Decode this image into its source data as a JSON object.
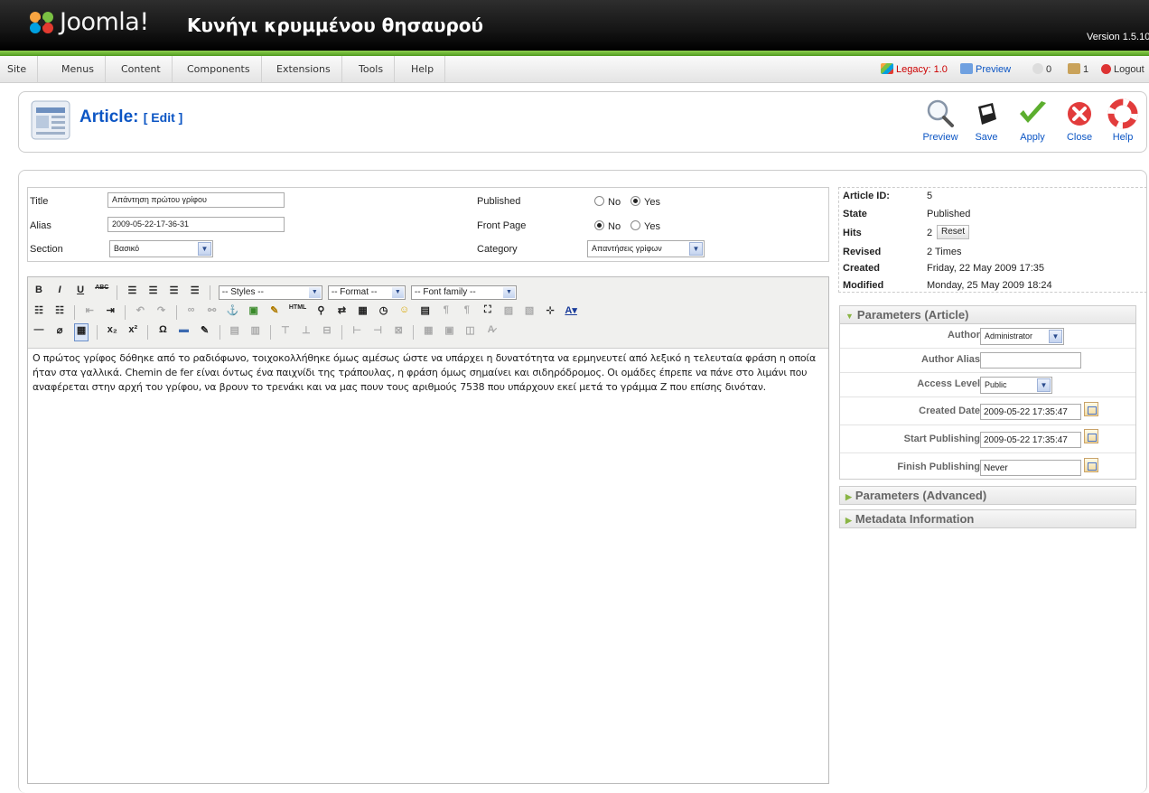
{
  "header": {
    "logo_text": "Joomla!",
    "site_title": "Κυνήγι κρυμμένου θησαυρού",
    "version": "Version 1.5.10"
  },
  "menu": {
    "items": [
      "Site",
      "Menus",
      "Content",
      "Components",
      "Extensions",
      "Tools",
      "Help"
    ],
    "status": {
      "legacy": "Legacy: 1.0",
      "preview": "Preview",
      "messages": "0",
      "users": "1",
      "logout": "Logout"
    }
  },
  "toolbar": {
    "title": "Article:",
    "subtitle": "[ Edit ]",
    "buttons": [
      "Preview",
      "Save",
      "Apply",
      "Close",
      "Help"
    ]
  },
  "details": {
    "title_label": "Title",
    "title_value": "Απάντηση πρώτου γρίφου",
    "alias_label": "Alias",
    "alias_value": "2009-05-22-17-36-31",
    "section_label": "Section",
    "section_value": "Βασικό",
    "published_label": "Published",
    "frontpage_label": "Front Page",
    "category_label": "Category",
    "category_value": "Απαντήσεις γρίφων",
    "no_label": "No",
    "yes_label": "Yes",
    "published": "Yes",
    "frontpage": "No"
  },
  "editor": {
    "styles": "-- Styles --",
    "format": "-- Format --",
    "font_family": "-- Font family --",
    "content": "Ο πρώτος γρίφος δόθηκε από το ραδιόφωνο, τοιχοκολλήθηκε όμως αμέσως ώστε να υπάρχει η δυνατότητα να ερμηνευτεί από λεξικό η τελευταία φράση η οποία ήταν στα γαλλικά. Chemin de fer είναι όντως ένα παιχνίδι της τράπουλας, η φράση όμως σημαίνει και σιδηρόδρομος. Οι ομάδες έπρεπε να πάνε στο λιμάνι που αναφέρεται στην αρχή του γρίφου, να βρουν το τρενάκι και να μας πουν τους αριθμούς 7538 που υπάρχουν εκεί μετά το γράμμα Ζ που επίσης δινόταν."
  },
  "info": {
    "article_id_label": "Article ID:",
    "article_id": "5",
    "state_label": "State",
    "state": "Published",
    "hits_label": "Hits",
    "hits": "2",
    "reset_label": "Reset",
    "revised_label": "Revised",
    "revised": "2 Times",
    "created_label": "Created",
    "created": "Friday, 22 May 2009 17:35",
    "modified_label": "Modified",
    "modified": "Monday, 25 May 2009 18:24"
  },
  "params": {
    "article_header": "Parameters (Article)",
    "author_label": "Author",
    "author_value": "Administrator",
    "author_alias_label": "Author Alias",
    "author_alias_value": "",
    "access_label": "Access Level",
    "access_value": "Public",
    "created_date_label": "Created Date",
    "created_date_value": "2009-05-22 17:35:47",
    "start_label": "Start Publishing",
    "start_value": "2009-05-22 17:35:47",
    "finish_label": "Finish Publishing",
    "finish_value": "Never",
    "advanced_header": "Parameters (Advanced)",
    "metadata_header": "Metadata Information"
  },
  "colors": {
    "link_blue": "#0b55c4",
    "green_bar": "#6bbf2a"
  }
}
